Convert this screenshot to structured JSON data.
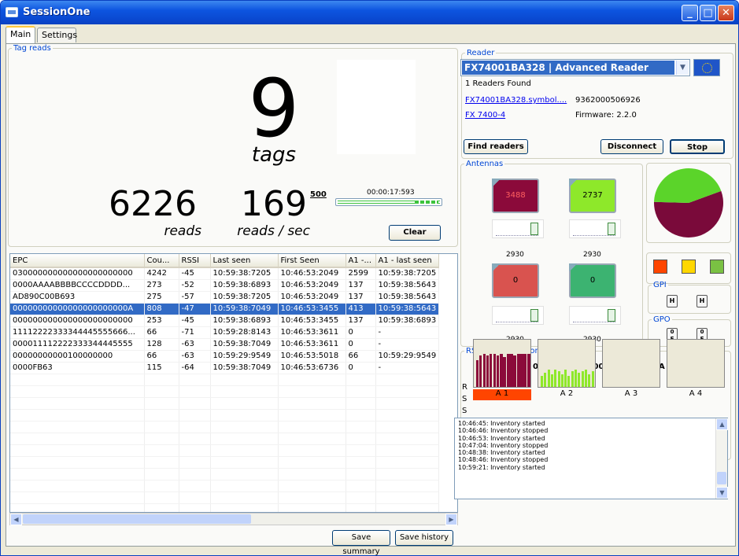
{
  "window": {
    "title": "SessionOne"
  },
  "tabs": [
    {
      "label": "Main"
    },
    {
      "label": "Settings"
    }
  ],
  "tag_reads": {
    "legend": "Tag reads",
    "tag_count": "9",
    "tags_label": "tags",
    "reads_value": "6226",
    "reads_label": "reads",
    "rate_value": "169",
    "rate_label": "reads / sec",
    "rate_max": "500",
    "timer": "00:00:17:593",
    "clear_button": "Clear"
  },
  "grid": {
    "columns": [
      "EPC",
      "Cou...",
      "RSSI",
      "Last seen",
      "First Seen",
      "A1 -...",
      "A1 - last seen"
    ],
    "rows": [
      [
        "030000000000000000000000",
        "4242",
        "-45",
        "10:59:38:7205",
        "10:46:53:2049",
        "2599",
        "10:59:38:7205"
      ],
      [
        "0000AAAABBBBCCCCDDDD...",
        "273",
        "-52",
        "10:59:38:6893",
        "10:46:53:2049",
        "137",
        "10:59:38:5643"
      ],
      [
        "AD890C00B693",
        "275",
        "-57",
        "10:59:38:7205",
        "10:46:53:2049",
        "137",
        "10:59:38:5643"
      ],
      [
        "00000000000000000000000A",
        "808",
        "-47",
        "10:59:38:7049",
        "10:46:53:3455",
        "413",
        "10:59:38:5643"
      ],
      [
        "000000000000000000000000",
        "253",
        "-45",
        "10:59:38:6893",
        "10:46:53:3455",
        "137",
        "10:59:38:6893"
      ],
      [
        "1111222233334444555566​6...",
        "66",
        "-71",
        "10:59:28:8143",
        "10:46:53:3611",
        "0",
        "-"
      ],
      [
        "000011112222333344445555",
        "128",
        "-63",
        "10:59:38:7049",
        "10:46:53:3611",
        "0",
        "-"
      ],
      [
        "00000000000100000000",
        "66",
        "-63",
        "10:59:29:9549",
        "10:46:53:5018",
        "66",
        "10:59:29:9549"
      ],
      [
        "0000FB63",
        "115",
        "-64",
        "10:59:38:7049",
        "10:46:53:6736",
        "0",
        "-"
      ]
    ],
    "selected_row": 3
  },
  "footer": {
    "save_summary": "Save summary",
    "save_history": "Save history"
  },
  "reader": {
    "legend": "Reader",
    "selected": "FX74001BA328  |  Advanced Reader",
    "found": "1 Readers Found",
    "host_link": "FX74001BA328.symbol....",
    "serial": "9362000506926",
    "model_link": "FX 7400-4",
    "firmware": "Firmware: 2.2.0",
    "find_button": "Find readers",
    "disconnect_button": "Disconnect",
    "stop_button": "Stop"
  },
  "antennas": {
    "legend": "Antennas",
    "items": [
      {
        "count": "3488",
        "power": "2930",
        "color": "#8b0a3a"
      },
      {
        "count": "2737",
        "power": "2930",
        "color": "#8ee82a"
      },
      {
        "count": "0",
        "power": "2930",
        "color": "#d9534f"
      },
      {
        "count": "0",
        "power": "2930",
        "color": "#3cb371"
      }
    ],
    "pie_slices": [
      {
        "value": 3488,
        "color": "#7a0a3a"
      },
      {
        "value": 2737,
        "color": "#5bd42a"
      }
    ]
  },
  "indicators": [
    "#ff4500",
    "#ffd700",
    "#7ac143"
  ],
  "gpi": {
    "legend": "GPI",
    "buttons": [
      "H",
      "H"
    ]
  },
  "gpo": {
    "legend": "GPO",
    "buttons": [
      "0 F",
      "0 F"
    ]
  },
  "rssi": {
    "legend": "RSSI/Direction/Zone",
    "selected_epc": "00000000000000000000000A",
    "axis_letters": [
      "R",
      "S",
      "S",
      "I"
    ],
    "zones": [
      {
        "label": "A 1",
        "bar_color": "#8b0a3a",
        "active": true
      },
      {
        "label": "A 2",
        "bar_color": "#8ee82a",
        "active": false
      },
      {
        "label": "A 3",
        "bar_color": "",
        "active": false
      },
      {
        "label": "A 4",
        "bar_color": "",
        "active": false
      }
    ]
  },
  "log": [
    "10:46:45: Inventory started",
    "10:46:46: Inventory stopped",
    "10:46:53: Inventory started",
    "10:47:04: Inventory stopped",
    "10:48:38: Inventory started",
    "10:48:46: Inventory stopped",
    "10:59:21: Inventory started"
  ]
}
